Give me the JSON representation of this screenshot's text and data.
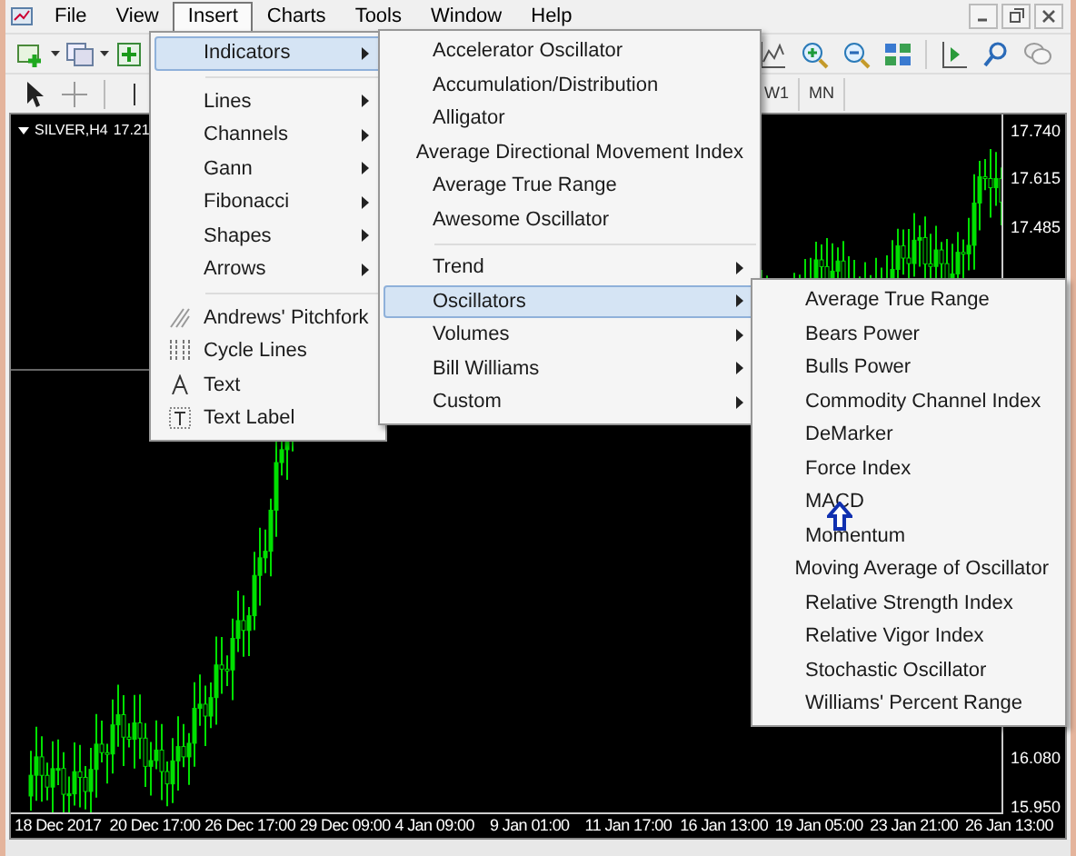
{
  "menu_bar": [
    {
      "label": "File",
      "selected": false
    },
    {
      "label": "View",
      "selected": false
    },
    {
      "label": "Insert",
      "selected": true
    },
    {
      "label": "Charts",
      "selected": false
    },
    {
      "label": "Tools",
      "selected": false
    },
    {
      "label": "Window",
      "selected": false
    },
    {
      "label": "Help",
      "selected": false
    }
  ],
  "timeframes": [
    "W1",
    "MN"
  ],
  "chart": {
    "symbol": "SILVER,H4",
    "price": "17.21",
    "price_axis": [
      "17.740",
      "17.615",
      "17.485",
      "16.080",
      "15.950"
    ],
    "time_axis": [
      "18 Dec 2017",
      "20 Dec 17:00",
      "26 Dec 17:00",
      "29 Dec 09:00",
      "4 Jan 09:00",
      "9 Jan 01:00",
      "11 Jan 17:00",
      "16 Jan 13:00",
      "19 Jan 05:00",
      "23 Jan 21:00",
      "26 Jan 13:00"
    ]
  },
  "insert_menu": {
    "groups": [
      [
        {
          "label": "Indicators",
          "has_submenu": true,
          "selected": true
        }
      ],
      [
        {
          "label": "Lines",
          "has_submenu": true,
          "selected": false
        },
        {
          "label": "Channels",
          "has_submenu": true,
          "selected": false
        },
        {
          "label": "Gann",
          "has_submenu": true,
          "selected": false
        },
        {
          "label": "Fibonacci",
          "has_submenu": true,
          "selected": false
        },
        {
          "label": "Shapes",
          "has_submenu": true,
          "selected": false
        },
        {
          "label": "Arrows",
          "has_submenu": true,
          "selected": false
        }
      ],
      [
        {
          "label": "Andrews' Pitchfork",
          "has_submenu": false,
          "selected": false
        },
        {
          "label": "Cycle Lines",
          "has_submenu": false,
          "selected": false
        },
        {
          "label": "Text",
          "has_submenu": false,
          "selected": false
        },
        {
          "label": "Text Label",
          "has_submenu": false,
          "selected": false
        }
      ]
    ]
  },
  "indicators_menu": {
    "groups": [
      [
        {
          "label": "Accelerator Oscillator",
          "has_submenu": false,
          "selected": false
        },
        {
          "label": "Accumulation/Distribution",
          "has_submenu": false,
          "selected": false
        },
        {
          "label": "Alligator",
          "has_submenu": false,
          "selected": false
        },
        {
          "label": "Average Directional Movement Index",
          "has_submenu": false,
          "selected": false
        },
        {
          "label": "Average True Range",
          "has_submenu": false,
          "selected": false
        },
        {
          "label": "Awesome Oscillator",
          "has_submenu": false,
          "selected": false
        }
      ],
      [
        {
          "label": "Trend",
          "has_submenu": true,
          "selected": false
        },
        {
          "label": "Oscillators",
          "has_submenu": true,
          "selected": true
        },
        {
          "label": "Volumes",
          "has_submenu": true,
          "selected": false
        },
        {
          "label": "Bill Williams",
          "has_submenu": true,
          "selected": false
        },
        {
          "label": "Custom",
          "has_submenu": true,
          "selected": false
        }
      ]
    ]
  },
  "oscillators_menu": {
    "groups": [
      [
        {
          "label": "Average True Range",
          "has_submenu": false,
          "selected": false
        },
        {
          "label": "Bears Power",
          "has_submenu": false,
          "selected": false
        },
        {
          "label": "Bulls Power",
          "has_submenu": false,
          "selected": false
        },
        {
          "label": "Commodity Channel Index",
          "has_submenu": false,
          "selected": false
        },
        {
          "label": "DeMarker",
          "has_submenu": false,
          "selected": false
        },
        {
          "label": "Force Index",
          "has_submenu": false,
          "selected": false
        },
        {
          "label": "MACD",
          "has_submenu": false,
          "selected": false
        },
        {
          "label": "Momentum",
          "has_submenu": false,
          "selected": false
        },
        {
          "label": "Moving Average of Oscillator",
          "has_submenu": false,
          "selected": false
        },
        {
          "label": "Relative Strength Index",
          "has_submenu": false,
          "selected": false
        },
        {
          "label": "Relative Vigor Index",
          "has_submenu": false,
          "selected": false
        },
        {
          "label": "Stochastic Oscillator",
          "has_submenu": false,
          "selected": false
        },
        {
          "label": "Williams' Percent Range",
          "has_submenu": false,
          "selected": false
        }
      ]
    ]
  }
}
